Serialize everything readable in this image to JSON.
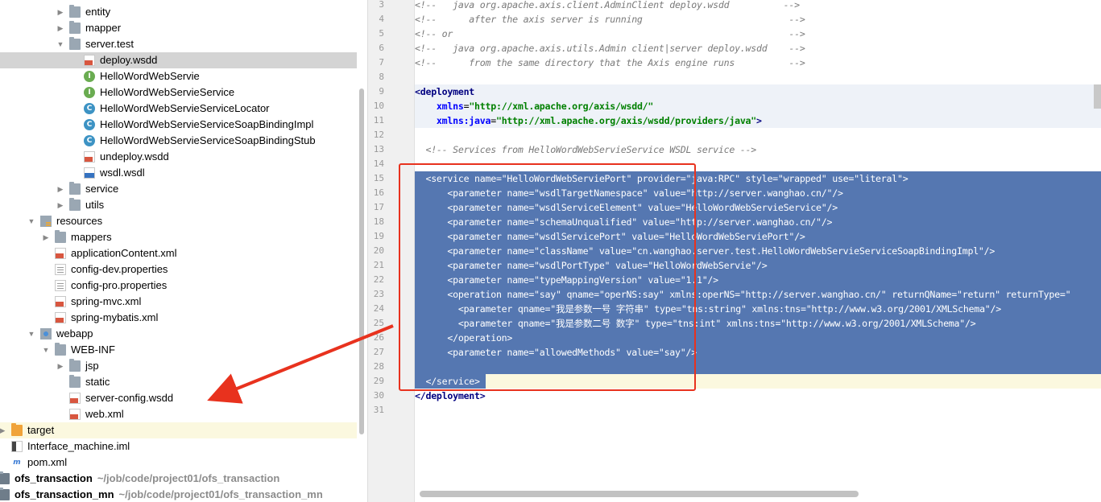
{
  "tree": {
    "items": [
      {
        "label": "entity",
        "icon": "folder-icon",
        "indent": 88,
        "arrow": "right"
      },
      {
        "label": "mapper",
        "icon": "folder-icon",
        "indent": 88,
        "arrow": "right"
      },
      {
        "label": "server.test",
        "icon": "folder-icon",
        "indent": 88,
        "arrow": "down"
      },
      {
        "label": "deploy.wsdd",
        "icon": "xml-file-icon",
        "indent": 106,
        "selected": true
      },
      {
        "label": "HelloWordWebServie",
        "icon": "interface-icon",
        "indent": 106
      },
      {
        "label": "HelloWordWebServieService",
        "icon": "interface-icon",
        "indent": 106
      },
      {
        "label": "HelloWordWebServieServiceLocator",
        "icon": "class-icon",
        "indent": 106
      },
      {
        "label": "HelloWordWebServieServiceSoapBindingImpl",
        "icon": "class-icon",
        "indent": 106
      },
      {
        "label": "HelloWordWebServieServiceSoapBindingStub",
        "icon": "class-icon",
        "indent": 106
      },
      {
        "label": "undeploy.wsdd",
        "icon": "xml-file-icon",
        "indent": 106
      },
      {
        "label": "wsdl.wsdl",
        "icon": "wsdl-file-icon",
        "indent": 106
      },
      {
        "label": "service",
        "icon": "folder-icon",
        "indent": 88,
        "arrow": "right"
      },
      {
        "label": "utils",
        "icon": "folder-icon",
        "indent": 88,
        "arrow": "right"
      },
      {
        "label": "resources",
        "icon": "resources-folder-icon",
        "indent": 52,
        "arrow": "down"
      },
      {
        "label": "mappers",
        "icon": "folder-icon",
        "indent": 70,
        "arrow": "right"
      },
      {
        "label": "applicationContent.xml",
        "icon": "xml-file-icon",
        "indent": 70
      },
      {
        "label": "config-dev.properties",
        "icon": "properties-file-icon",
        "indent": 70
      },
      {
        "label": "config-pro.properties",
        "icon": "properties-file-icon",
        "indent": 70
      },
      {
        "label": "spring-mvc.xml",
        "icon": "xml-file-icon",
        "indent": 70
      },
      {
        "label": "spring-mybatis.xml",
        "icon": "xml-file-icon",
        "indent": 70
      },
      {
        "label": "webapp",
        "icon": "web-folder-icon",
        "indent": 52,
        "arrow": "down"
      },
      {
        "label": "WEB-INF",
        "icon": "folder-icon",
        "indent": 70,
        "arrow": "down"
      },
      {
        "label": "jsp",
        "icon": "folder-icon",
        "indent": 88,
        "arrow": "right"
      },
      {
        "label": "static",
        "icon": "folder-icon",
        "indent": 88
      },
      {
        "label": "server-config.wsdd",
        "icon": "xml-file-icon",
        "indent": 88
      },
      {
        "label": "web.xml",
        "icon": "xml-file-icon",
        "indent": 88
      },
      {
        "label": "target",
        "icon": "target-folder-icon",
        "indent": 16,
        "arrow": "right",
        "highlight": true
      },
      {
        "label": "Interface_machine.iml",
        "icon": "iml-file-icon",
        "indent": 16
      },
      {
        "label": "pom.xml",
        "icon": "maven-pom-icon",
        "indent": 16
      },
      {
        "label": "ofs_transaction",
        "icon": "module-folder-icon",
        "indent": 0,
        "arrow": "right",
        "bold": true,
        "path": "~/job/code/project01/ofs_transaction"
      },
      {
        "label": "ofs_transaction_mn",
        "icon": "module-folder-icon",
        "indent": 0,
        "arrow": "right",
        "bold": true,
        "path": "~/job/code/project01/ofs_transaction_mn"
      }
    ]
  },
  "editor": {
    "lines": [
      {
        "n": "3",
        "parts": [
          [
            "cm",
            "<!--   java org.apache.axis.client.AdminClient deploy.wsdd          -->"
          ]
        ]
      },
      {
        "n": "4",
        "parts": [
          [
            "cm",
            "<!--      after the axis server is running                           -->"
          ]
        ]
      },
      {
        "n": "5",
        "parts": [
          [
            "cm",
            "<!-- or                                                              -->"
          ]
        ]
      },
      {
        "n": "6",
        "parts": [
          [
            "cm",
            "<!--   java org.apache.axis.utils.Admin client|server deploy.wsdd    -->"
          ]
        ]
      },
      {
        "n": "7",
        "parts": [
          [
            "cm",
            "<!--      from the same directory that the Axis engine runs          -->"
          ]
        ]
      },
      {
        "n": "8",
        "parts": []
      },
      {
        "n": "9",
        "band": true,
        "parts": [
          [
            "tag",
            "<deployment"
          ]
        ]
      },
      {
        "n": "10",
        "band": true,
        "parts": [
          [
            "",
            "    "
          ],
          [
            "attr",
            "xmlns"
          ],
          [
            "",
            "="
          ],
          [
            "val",
            "\"http://xml.apache.org/axis/wsdd/\""
          ]
        ]
      },
      {
        "n": "11",
        "band": true,
        "parts": [
          [
            "",
            "    "
          ],
          [
            "attr",
            "xmlns:java"
          ],
          [
            "",
            "="
          ],
          [
            "val",
            "\"http://xml.apache.org/axis/wsdd/providers/java\""
          ],
          [
            "tag",
            ">"
          ]
        ]
      },
      {
        "n": "12",
        "parts": []
      },
      {
        "n": "13",
        "parts": [
          [
            "cm",
            "  <!-- Services from HelloWordWebServieService WSDL service -->"
          ]
        ]
      },
      {
        "n": "14",
        "parts": []
      },
      {
        "n": "15",
        "sel": true,
        "parts": [
          [
            "",
            "  <service name=\"HelloWordWebServiePort\" provider=\"java:RPC\" style=\"wrapped\" use=\"literal\">"
          ]
        ]
      },
      {
        "n": "16",
        "sel": true,
        "parts": [
          [
            "",
            "      <parameter name=\"wsdlTargetNamespace\" value=\"http://server.wanghao.cn/\"/>"
          ]
        ]
      },
      {
        "n": "17",
        "sel": true,
        "parts": [
          [
            "",
            "      <parameter name=\"wsdlServiceElement\" value=\"HelloWordWebServieService\"/>"
          ]
        ]
      },
      {
        "n": "18",
        "sel": true,
        "parts": [
          [
            "",
            "      <parameter name=\"schemaUnqualified\" value=\"http://server.wanghao.cn/\"/>"
          ]
        ]
      },
      {
        "n": "19",
        "sel": true,
        "parts": [
          [
            "",
            "      <parameter name=\"wsdlServicePort\" value=\"HelloWordWebServiePort\"/>"
          ]
        ]
      },
      {
        "n": "20",
        "sel": true,
        "parts": [
          [
            "",
            "      <parameter name=\"className\" value=\"cn.wanghao.server.test.HelloWordWebServieServiceSoapBindingImpl\"/>"
          ]
        ]
      },
      {
        "n": "21",
        "sel": true,
        "parts": [
          [
            "",
            "      <parameter name=\"wsdlPortType\" value=\"HelloWordWebServie\"/>"
          ]
        ]
      },
      {
        "n": "22",
        "sel": true,
        "parts": [
          [
            "",
            "      <parameter name=\"typeMappingVersion\" value=\"1.1\"/>"
          ]
        ]
      },
      {
        "n": "23",
        "sel": true,
        "parts": [
          [
            "",
            "      <operation name=\"say\" qname=\"operNS:say\" xmlns:operNS=\"http://server.wanghao.cn/\" returnQName=\"return\" returnType=\""
          ]
        ]
      },
      {
        "n": "24",
        "sel": true,
        "parts": [
          [
            "",
            "        <parameter qname=\"我是参数一号 字符串\" type=\"tns:string\" xmlns:tns=\"http://www.w3.org/2001/XMLSchema\"/>"
          ]
        ]
      },
      {
        "n": "25",
        "sel": true,
        "parts": [
          [
            "",
            "        <parameter qname=\"我是参数二号 数字\" type=\"tns:int\" xmlns:tns=\"http://www.w3.org/2001/XMLSchema\"/>"
          ]
        ]
      },
      {
        "n": "26",
        "sel": true,
        "parts": [
          [
            "",
            "      </operation>"
          ]
        ]
      },
      {
        "n": "27",
        "sel": true,
        "parts": [
          [
            "",
            "      <parameter name=\"allowedMethods\" value=\"say\"/>"
          ]
        ]
      },
      {
        "n": "28",
        "sel": true,
        "parts": [
          [
            "",
            ""
          ]
        ]
      },
      {
        "n": "29",
        "sel": true,
        "current": true,
        "parts": [
          [
            "",
            "  </service>"
          ]
        ]
      },
      {
        "n": "30",
        "parts": [
          [
            "tag",
            "</deployment>"
          ]
        ]
      },
      {
        "n": "31",
        "parts": []
      }
    ]
  }
}
